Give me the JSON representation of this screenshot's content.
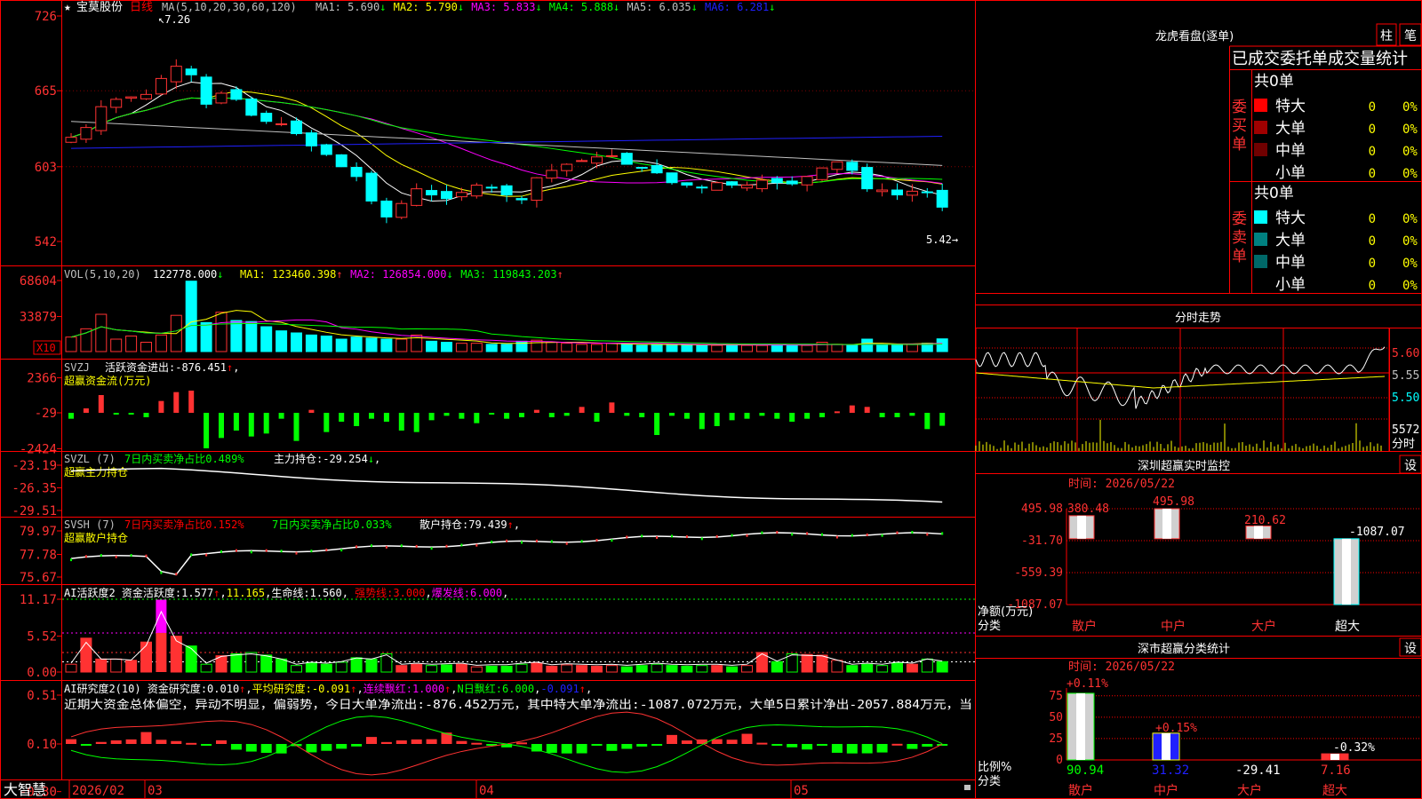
{
  "colors": {
    "up": "#ff3232",
    "down": "#00ffff",
    "green": "#00ff00",
    "yellow": "#ffff00",
    "white": "#ffffff",
    "magenta": "#ff00ff",
    "gray": "#c0c0c0",
    "blue": "#2020ff",
    "border": "#ff0000"
  },
  "header": {
    "star": "★",
    "stock_name": "宝莫股份",
    "period": "日线",
    "ma_param": "MA(5,10,20,30,60,120)",
    "ma_items": [
      {
        "label": "MA1:",
        "value": "5.690",
        "arrow": "↓",
        "color": "#c0c0c0"
      },
      {
        "label": "MA2:",
        "value": "5.790",
        "arrow": "↓",
        "color": "#ffff00"
      },
      {
        "label": "MA3:",
        "value": "5.833",
        "arrow": "↓",
        "color": "#ff00ff"
      },
      {
        "label": "MA4:",
        "value": "5.888",
        "arrow": "↓",
        "color": "#00ff00"
      },
      {
        "label": "MA5:",
        "value": "6.035",
        "arrow": "↓",
        "color": "#c0c0c0"
      },
      {
        "label": "MA6:",
        "value": "6.281",
        "arrow": "↓",
        "color": "#2020ff"
      }
    ]
  },
  "price_panel": {
    "y_ticks": [
      "726",
      "665",
      "603",
      "542"
    ],
    "high_label": "7.26",
    "low_label": "5.42"
  },
  "vol_panel": {
    "title": "VOL(5,10,20)",
    "value": "122778.000",
    "items": [
      {
        "label": "MA1:",
        "value": "123460.398",
        "arrow": "↑",
        "color": "#ffff00"
      },
      {
        "label": "MA2:",
        "value": "126854.000",
        "arrow": "↓",
        "color": "#ff00ff"
      },
      {
        "label": "MA3:",
        "value": "119843.203",
        "arrow": "↑",
        "color": "#00ff00"
      }
    ],
    "y_ticks": [
      "68604",
      "33879"
    ],
    "unit": "X10"
  },
  "svzj_panel": {
    "title": "SVZJ",
    "label": "活跃资金进出:",
    "value": "-876.451",
    "subtitle": "超赢资金流(万元)",
    "y_ticks": [
      "2366",
      "-29",
      "-2424"
    ]
  },
  "svzl_panel": {
    "title": "SVZL (7)",
    "ratio_label": "7日内买卖净占比0.489%",
    "hold_label": "主力持仓:",
    "hold_value": "-29.254",
    "subtitle": "超赢主力持仓",
    "y_ticks": [
      "-23.19",
      "-26.35",
      "-29.51"
    ]
  },
  "svsh_panel": {
    "title": "SVSH (7)",
    "ratio1": "7日内买卖净占比0.152%",
    "ratio2": "7日内买卖净占比0.033%",
    "hold_label": "散户持仓:",
    "hold_value": "79.439",
    "subtitle": "超赢散户持仓",
    "y_ticks": [
      "79.97",
      "77.78",
      "75.67"
    ]
  },
  "ai1_panel": {
    "title": "AI活跃度2",
    "act_label": "资金活跃度:",
    "act_value": "1.577",
    "second_value": "11.165",
    "life_label": "生命线:",
    "life_value": "1.560",
    "strong_label": "强势线:",
    "strong_value": "3.000",
    "burst_label": "爆发线:",
    "burst_value": "6.000",
    "y_ticks": [
      "11.17",
      "5.52",
      "0.00"
    ]
  },
  "ai2_panel": {
    "title": "AI研究度2(10)",
    "res_label": "资金研究度:",
    "res_value": "0.010",
    "avg_label": "平均研究度:",
    "avg_value": "-0.091",
    "red_label": "连续飘红:",
    "red_value": "1.000",
    "nred_label": "N日飘红:",
    "nred_value": "6.000",
    "last_value": "-0.091",
    "summary": "近期大资金总体偏空，异动不明显，偏弱势，今日大单净流出:-876.452万元，其中特大单净流出:-1087.072万元，大单5日累计净出-2057.884万元，当",
    "y_ticks": [
      "0.51",
      "0.10",
      "-0.30"
    ]
  },
  "bottom_bar": {
    "brand": "大智慧",
    "dates": [
      "2026/02",
      "03",
      "04",
      "05"
    ]
  },
  "right_panel": {
    "longhu_title": "龙虎看盘(逐单)",
    "btn_zhu": "柱",
    "btn_bi": "笔",
    "stat_title": "已成交委托单成交量统计",
    "buy_group": {
      "label": "委买单",
      "total": "共0单",
      "rows": [
        {
          "name": "特大",
          "value": "0",
          "pct": "0%",
          "swatch": "#ff0000"
        },
        {
          "name": "大单",
          "value": "0",
          "pct": "0%",
          "swatch": "#a00000"
        },
        {
          "name": "中单",
          "value": "0",
          "pct": "0%",
          "swatch": "#700000"
        },
        {
          "name": "小单",
          "value": "0",
          "pct": "0%",
          "swatch": ""
        }
      ]
    },
    "sell_group": {
      "label": "委卖单",
      "total": "共0单",
      "rows": [
        {
          "name": "特大",
          "value": "0",
          "pct": "0%",
          "swatch": "#00ffff"
        },
        {
          "name": "大单",
          "value": "0",
          "pct": "0%",
          "swatch": "#008080"
        },
        {
          "name": "中单",
          "value": "0",
          "pct": "0%",
          "swatch": "#006868"
        },
        {
          "name": "小单",
          "value": "0",
          "pct": "0%",
          "swatch": ""
        }
      ]
    },
    "intraday": {
      "title": "分时走势",
      "price_ticks": [
        "5.60",
        "5.55",
        "5.50"
      ],
      "vol_tick": "5572",
      "vol_unit": "分时"
    },
    "monitor": {
      "title": "深圳超赢实时监控",
      "set_btn": "设",
      "time_label": "时间: 2026/05/22",
      "y_ticks": [
        "495.98",
        "-31.70",
        "-559.39",
        "-1087.07"
      ],
      "bar_labels": [
        "380.48",
        "495.98",
        "210.62",
        "-1087.07"
      ],
      "categories": [
        "散户",
        "中户",
        "大户",
        "超大"
      ],
      "axis_title": "净额(万元)",
      "axis_sub": "分类"
    },
    "classify": {
      "title": "深市超赢分类统计",
      "set_btn": "设",
      "time_label": "时间: 2026/05/22",
      "y_ticks": [
        "75",
        "50",
        "25",
        "0"
      ],
      "top_labels": [
        "+0.11%",
        "+0.15%",
        "-0.32%"
      ],
      "bottom_values": [
        "90.94",
        "31.32",
        "-29.41",
        "7.16"
      ],
      "categories": [
        "散户",
        "中户",
        "大户",
        "超大"
      ],
      "axis_title": "比例%",
      "axis_sub": "分类"
    }
  },
  "chart_data": [
    {
      "type": "candlestick",
      "title": "宝莫股份 日线",
      "ylim": [
        5.42,
        7.26
      ],
      "y_ticks": [
        7.26,
        6.65,
        6.03,
        5.42
      ],
      "x_ticks": [
        "2026/02",
        "03",
        "04",
        "05"
      ],
      "high": 7.26,
      "low": 5.42,
      "series": [
        {
          "name": "MA1",
          "last": 5.69
        },
        {
          "name": "MA2",
          "last": 5.79
        },
        {
          "name": "MA3",
          "last": 5.833
        },
        {
          "name": "MA4",
          "last": 5.888
        },
        {
          "name": "MA5",
          "last": 6.035
        },
        {
          "name": "MA6",
          "last": 6.281
        }
      ]
    },
    {
      "type": "bar",
      "title": "VOL(5,10,20)",
      "y_ticks": [
        68604,
        33879
      ],
      "last": 122778.0
    },
    {
      "type": "bar",
      "title": "SVZJ 超赢资金流(万元)",
      "y_ticks": [
        2366,
        -29,
        -2424
      ],
      "last": -876.451
    },
    {
      "type": "line",
      "title": "SVZL 超赢主力持仓",
      "y_ticks": [
        -23.19,
        -26.35,
        -29.51
      ],
      "last": -29.254
    },
    {
      "type": "line",
      "title": "SVSH 超赢散户持仓",
      "y_ticks": [
        79.97,
        77.78,
        75.67
      ],
      "last": 79.439
    },
    {
      "type": "bar",
      "title": "AI活跃度2",
      "y_ticks": [
        11.17,
        5.52,
        0.0
      ],
      "last": 1.577
    },
    {
      "type": "bar",
      "title": "AI研究度2(10)",
      "y_ticks": [
        0.51,
        0.1,
        -0.3
      ],
      "last": 0.01
    },
    {
      "type": "bar",
      "title": "深圳超赢实时监控",
      "categories": [
        "散户",
        "中户",
        "大户",
        "超大"
      ],
      "values": [
        380.48,
        495.98,
        210.62,
        -1087.07
      ],
      "ylim": [
        -1087.07,
        495.98
      ]
    },
    {
      "type": "bar",
      "title": "深市超赢分类统计",
      "categories": [
        "散户",
        "中户",
        "大户",
        "超大"
      ],
      "values": [
        90.94,
        31.32,
        -29.41,
        7.16
      ],
      "changes": [
        "+0.11%",
        "+0.15%",
        "",
        "-0.32%"
      ],
      "ylim": [
        0,
        75
      ]
    }
  ]
}
